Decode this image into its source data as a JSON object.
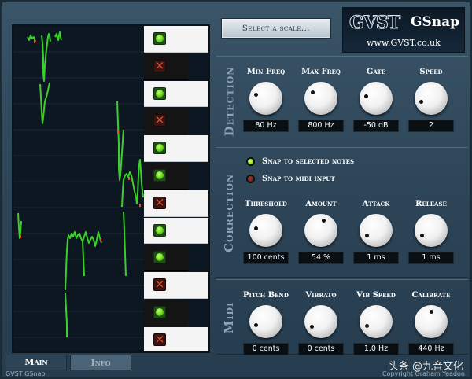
{
  "app": {
    "scale_button": "Select a scale...",
    "logo_gvst": "GVST",
    "logo_name": "GSnap",
    "logo_url": "www.GVST.co.uk"
  },
  "keyboard": {
    "keys": [
      {
        "type": "white",
        "state": "on"
      },
      {
        "type": "black",
        "state": "off"
      },
      {
        "type": "white",
        "state": "on"
      },
      {
        "type": "black",
        "state": "off"
      },
      {
        "type": "white",
        "state": "on"
      },
      {
        "type": "black",
        "state": "on"
      },
      {
        "type": "white",
        "state": "off"
      },
      {
        "type": "white",
        "state": "on"
      },
      {
        "type": "black",
        "state": "on"
      },
      {
        "type": "white",
        "state": "off"
      },
      {
        "type": "black",
        "state": "on"
      },
      {
        "type": "white",
        "state": "off"
      }
    ]
  },
  "detection": {
    "title": "Detection",
    "controls": [
      {
        "label": "Min Freq",
        "value": "80 Hz",
        "dial": 0.25
      },
      {
        "label": "Max Freq",
        "value": "800 Hz",
        "dial": 0.3
      },
      {
        "label": "Gate",
        "value": "-50 dB",
        "dial": 0.2
      },
      {
        "label": "Speed",
        "value": "2",
        "dial": 0.1
      }
    ]
  },
  "correction": {
    "title": "Correction",
    "options": [
      {
        "label": "Snap to selected notes",
        "selected": true
      },
      {
        "label": "Snap to midi input",
        "selected": false
      }
    ],
    "controls": [
      {
        "label": "Threshold",
        "value": "100 cents",
        "dial": 0.2
      },
      {
        "label": "Amount",
        "value": "54 %",
        "dial": 0.55
      },
      {
        "label": "Attack",
        "value": "1 ms",
        "dial": 0.05
      },
      {
        "label": "Release",
        "value": "1 ms",
        "dial": 0.05
      }
    ]
  },
  "midi": {
    "title": "Midi",
    "controls": [
      {
        "label": "Pitch Bend",
        "value": "0 cents",
        "dial": 0.1
      },
      {
        "label": "Vibrato",
        "value": "0 cents",
        "dial": 0.05
      },
      {
        "label": "Vib Speed",
        "value": "1.0 Hz",
        "dial": 0.08
      },
      {
        "label": "Calibrate",
        "value": "440 Hz",
        "dial": 0.5
      }
    ]
  },
  "tabs": [
    "Main",
    "Info"
  ],
  "footer": {
    "left": "GVST GSnap",
    "right": "Copyright Graham Yeadon",
    "watermark": "头条 @九音文化"
  },
  "colors": {
    "background": "#2d4557",
    "display": "#0c1722",
    "pitch_line": "#3ccf2a",
    "pitch_accent": "#e0532f",
    "readout_bg": "#0a0f13",
    "section_title": "#8ea3b4"
  }
}
